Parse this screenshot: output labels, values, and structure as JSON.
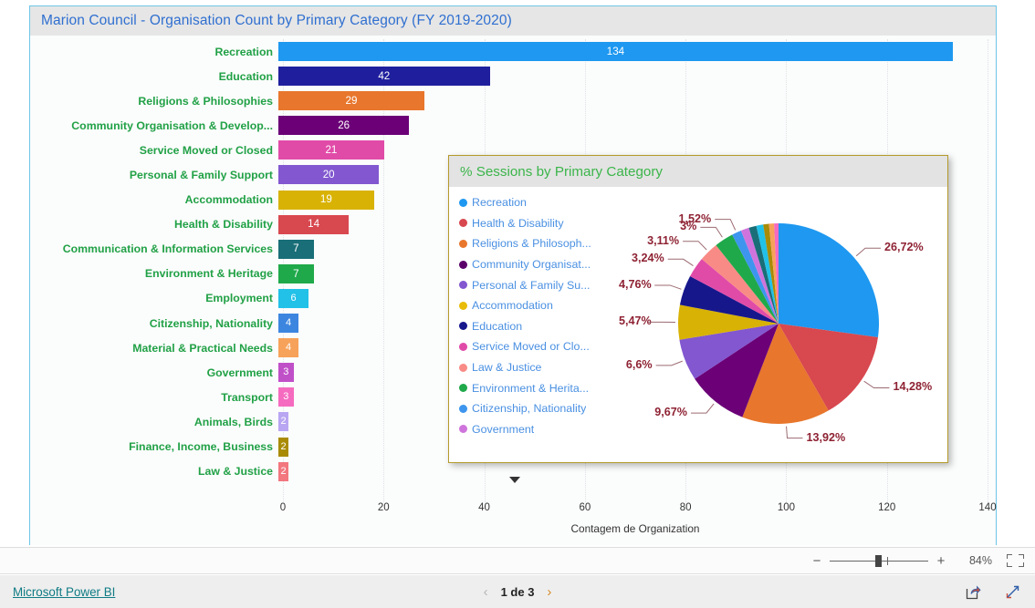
{
  "report": {
    "title": "Marion Council - Organisation Count by Primary Category (FY 2019-2020)",
    "title_color": "#2f6fd0",
    "border_color": "#6ec6e8"
  },
  "chart_data": [
    {
      "type": "bar",
      "orientation": "horizontal",
      "title": "Marion Council - Organisation Count by Primary Category (FY 2019-2020)",
      "xlabel": "Contagem de Organization",
      "ylabel": "",
      "xlim": [
        0,
        140
      ],
      "xticks": [
        "0",
        "20",
        "40",
        "60",
        "80",
        "100",
        "120",
        "140"
      ],
      "grid": true,
      "categories": [
        "Recreation",
        "Education",
        "Religions & Philosophies",
        "Community Organisation & Develop...",
        "Service Moved or Closed",
        "Personal & Family Support",
        "Accommodation",
        "Health & Disability",
        "Communication & Information Services",
        "Environment & Heritage",
        "Employment",
        "Citizenship, Nationality",
        "Material & Practical Needs",
        "Government",
        "Transport",
        "Animals, Birds",
        "Finance, Income, Business",
        "Law & Justice"
      ],
      "values": [
        134,
        42,
        29,
        26,
        21,
        20,
        19,
        14,
        7,
        7,
        6,
        4,
        4,
        3,
        3,
        2,
        2,
        2
      ],
      "colors": [
        "#1e98f0",
        "#1f1f9e",
        "#e8762c",
        "#6b0077",
        "#e14ba8",
        "#8257d0",
        "#d8b204",
        "#d8484f",
        "#196e78",
        "#1fa94a",
        "#21c1e8",
        "#3d86e0",
        "#f7a25a",
        "#c050c8",
        "#f56bc0",
        "#b9a6f2",
        "#a98b06",
        "#f2777f"
      ],
      "label_color": "#21a146"
    },
    {
      "type": "pie",
      "title": "% Sessions by Primary Category",
      "legend_position": "left",
      "legend_entries": [
        "Recreation",
        "Health & Disability",
        "Religions & Philosoph...",
        "Community Organisat...",
        "Personal & Family Su...",
        "Accommodation",
        "Education",
        "Service Moved or Clo...",
        "Law & Justice",
        "Environment & Herita...",
        "Citizenship, Nationality",
        "Government"
      ],
      "legend_colors": [
        "#1e98f0",
        "#d8484f",
        "#e8762c",
        "#5c0069",
        "#8257d0",
        "#e8bc08",
        "#17178c",
        "#e14ba8",
        "#f98b86",
        "#1fa94a",
        "#3d95ee",
        "#cf74dc"
      ],
      "labels_shown": [
        "26,72%",
        "14,28%",
        "13,92%",
        "9,67%",
        "6,6%",
        "5,47%",
        "4,76%",
        "3,24%",
        "3,11%",
        "3%",
        "1,52%"
      ],
      "slices": [
        {
          "label": "Recreation",
          "pct": 26.72,
          "shown": "26,72%",
          "color": "#1e98f0"
        },
        {
          "label": "Health & Disability",
          "pct": 14.28,
          "shown": "14,28%",
          "color": "#d8484f"
        },
        {
          "label": "Religions & Philosophies",
          "pct": 13.92,
          "shown": "13,92%",
          "color": "#e8762c"
        },
        {
          "label": "Community Organisation",
          "pct": 9.67,
          "shown": "9,67%",
          "color": "#6b0077"
        },
        {
          "label": "Personal & Family Support",
          "pct": 6.6,
          "shown": "6,6%",
          "color": "#8257d0"
        },
        {
          "label": "Accommodation",
          "pct": 5.47,
          "shown": "5,47%",
          "color": "#d8b204"
        },
        {
          "label": "Education",
          "pct": 4.76,
          "shown": "4,76%",
          "color": "#17178c"
        },
        {
          "label": "Service Moved or Closed",
          "pct": 3.24,
          "shown": "3,24%",
          "color": "#e14ba8"
        },
        {
          "label": "Law & Justice",
          "pct": 3.11,
          "shown": "3,11%",
          "color": "#f98b86"
        },
        {
          "label": "Environment & Heritage",
          "pct": 3.0,
          "shown": "3%",
          "color": "#1fa94a"
        },
        {
          "label": "Citizenship, Nationality",
          "pct": 1.52,
          "shown": "1,52%",
          "color": "#3d95ee"
        },
        {
          "label": "Government",
          "pct": 1.3,
          "shown": "",
          "color": "#cf74dc"
        },
        {
          "label": "Communication & Information",
          "pct": 1.2,
          "shown": "",
          "color": "#196e78"
        },
        {
          "label": "Employment",
          "pct": 1.1,
          "shown": "",
          "color": "#21c1e8"
        },
        {
          "label": "Finance, Income, Business",
          "pct": 0.9,
          "shown": "",
          "color": "#a98b06"
        },
        {
          "label": "Material & Practical Needs",
          "pct": 0.8,
          "shown": "",
          "color": "#f7a25a"
        },
        {
          "label": "Transport",
          "pct": 0.7,
          "shown": "",
          "color": "#f56bc0"
        }
      ],
      "label_color": "#8e2233",
      "title_color": "#3bb54a",
      "panel_border_color": "#b49a2c"
    }
  ],
  "pie_panel": {
    "title": "% Sessions by Primary Category",
    "more_icon": "chevron-down-icon"
  },
  "zoom_toolbar": {
    "minus": "−",
    "plus": "+",
    "percent": "84%",
    "fit_icon": "fit-to-screen-icon"
  },
  "footer": {
    "brand": "Microsoft Power BI",
    "prev_icon": "chevron-left-icon",
    "next_icon": "chevron-right-icon",
    "page_text": "1 de 3",
    "share_icon": "share-icon",
    "fullscreen_icon": "fullscreen-icon"
  }
}
